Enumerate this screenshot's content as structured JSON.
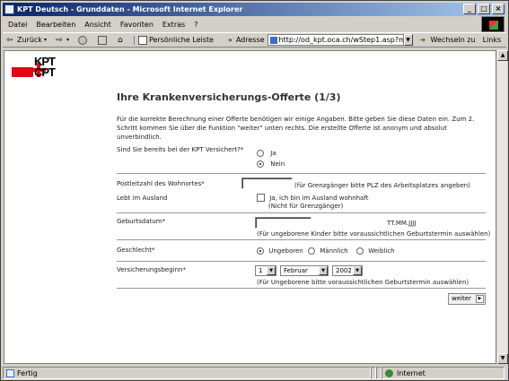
{
  "window": {
    "title": "KPT Deutsch - Grunddaten - Microsoft Internet Explorer"
  },
  "menu": [
    "Datei",
    "Bearbeiten",
    "Ansicht",
    "Favoriten",
    "Extras",
    "?"
  ],
  "toolbar": {
    "back": "Zurück",
    "personal_bar": "Persönliche Leiste",
    "address_label": "Adresse",
    "address_value": "http://od_kpt.oca.ch/wStep1.asp?m=",
    "go_label": "Wechseln zu",
    "links_label": "Links"
  },
  "page": {
    "logo_top": "KPT",
    "logo_bottom": "CPT",
    "heading": "Ihre Krankenversicherungs-Offerte (1/3)",
    "intro": "Für die korrekte Berechnung einer Offerte benötigen wir einige Angaben. Bitte geben Sie diese Daten ein. Zum 2. Schritt kommen Sie über die Funktion \"weiter\" unten rechts. Die erstellte Offerte ist anonym und absolut unverbindlich.",
    "q_insured": "Sind Sie bereits bei der KPT Versichert?*",
    "opt_ja": "Ja",
    "opt_nein": "Nein",
    "q_postal": "Postleitzahl des Wohnortes*",
    "postal_hint": "(für Grenzgänger bitte PLZ des Arbeitsplatzes angeben)",
    "q_abroad": "Lebt im Ausland",
    "abroad_check_label": "Ja, ich bin im Ausland wohnhaft",
    "abroad_note": "(Nicht für Grenzgänger)",
    "q_birth": "Geburtsdatum*",
    "birth_format": "TT.MM.JJJJ",
    "birth_hint": "(Für ungeborene Kinder bitte voraussichtlichen Geburtstermin auswählen)",
    "q_gender": "Geschlecht*",
    "gender_unborn": "Ungeboren",
    "gender_male": "Männlich",
    "gender_female": "Weiblich",
    "q_start": "Versicherungsbeginn*",
    "start_day": "1",
    "start_month": "Februar",
    "start_year": "2002",
    "start_hint": "(Für Ungeborene bitte voraussichtlichen Geburtstermin auswählen)",
    "next_button": "weiter"
  },
  "status": {
    "text": "Fertig",
    "zone": "Internet"
  }
}
